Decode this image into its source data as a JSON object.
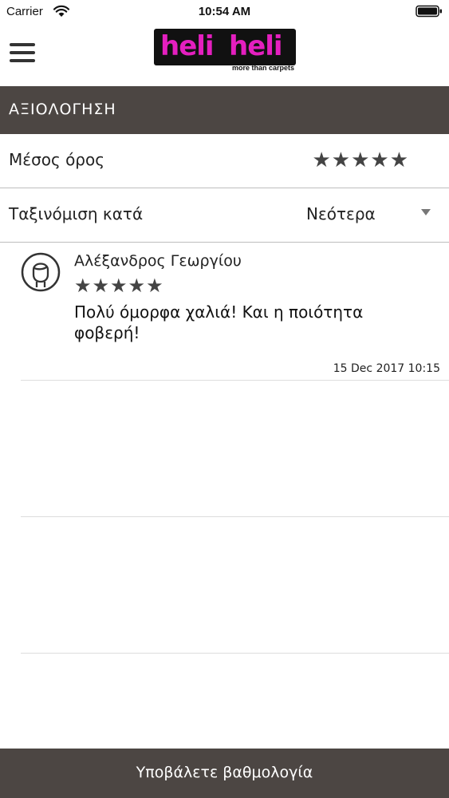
{
  "status_bar": {
    "carrier": "Carrier",
    "time": "10:54 AM"
  },
  "header": {
    "logo_word_1": "heli",
    "logo_word_2": "heli",
    "logo_tagline": "more than carpets",
    "logo_color": "#e41fbf"
  },
  "section": {
    "title": "ΑΞΙΟΛΟΓΗΣΗ"
  },
  "average": {
    "label": "Μέσος όρος",
    "stars": "★★★★★",
    "rating": 5,
    "max": 5
  },
  "sort": {
    "label": "Ταξινόμιση κατά",
    "selected": "Νεότερα"
  },
  "reviews": [
    {
      "name": "Αλέξανδρος Γεωργίου",
      "stars": "★★★★★",
      "rating": 5,
      "text": "Πολύ όμορφα χαλιά!  Και η ποιότητα φοβερή!",
      "date": "15 Dec 2017 10:15"
    }
  ],
  "submit": {
    "label": "Υποβάλετε βαθμολογία"
  },
  "colors": {
    "bar_background": "#4c4643",
    "star_color": "#444444"
  }
}
